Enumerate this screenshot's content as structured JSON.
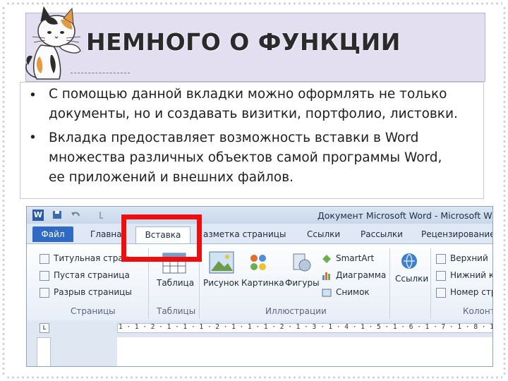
{
  "slide": {
    "title": "НЕМНОГО О ФУНКЦИИ",
    "bullets": [
      {
        "line1": "С помощью данной вкладки можно оформлять не только",
        "line2": "документы, но и создавать визитки, портфолио, листовки."
      },
      {
        "line1": "Вкладка предоставляет возможность вставки в Word",
        "line2": "множества различных объектов самой программы Word,",
        "line3": "ее приложений и внешних файлов."
      }
    ],
    "bullet_glyph": "•"
  },
  "word": {
    "app_icon": "W",
    "window_title": "Документ Microsoft Word - Microsoft W",
    "tabs": [
      "Файл",
      "Главная",
      "Вставка",
      "Разметка страницы",
      "Ссылки",
      "Рассылки",
      "Рецензирование"
    ],
    "tabs_display": {
      "file": "Файл",
      "home": "Главна",
      "insert": "Вставка",
      "layout": "азметка страницы",
      "refs": "Ссылки",
      "mail": "Рассылки",
      "review": "Рецензирование"
    },
    "pages_group": {
      "items": [
        "Титульная стран",
        "Пустая страница",
        "Разрыв страницы"
      ],
      "label": "Страницы"
    },
    "tables_group": {
      "button": "Таблица",
      "label": "Таблицы"
    },
    "illustrations_group": {
      "buttons": [
        "Рисунок",
        "Картинка",
        "Фигуры"
      ],
      "side_items": [
        "SmartArt",
        "Диаграмма",
        "Снимок"
      ],
      "label": "Иллюстрации"
    },
    "links_group": {
      "button": "Ссылки"
    },
    "header_group": {
      "items": [
        "Верхний",
        "Нижний к",
        "Номер стр"
      ],
      "label": "Колонт"
    },
    "ruler_text": "1 · 1 · 2 · 1 · 1 · 1 · 2 · 1 · 1 · 1 · 2 · 1 · 3 · 1 · 4 · 1 · 5 · 1 · 6 · 1 · 7 · 1 · 8 · 1 · 9 · 1 · 10",
    "ruler_button": "L"
  },
  "colors": {
    "highlight": "#ee0e0e",
    "file_tab": "#2f6bc4",
    "title_band": "#e4dff0"
  }
}
